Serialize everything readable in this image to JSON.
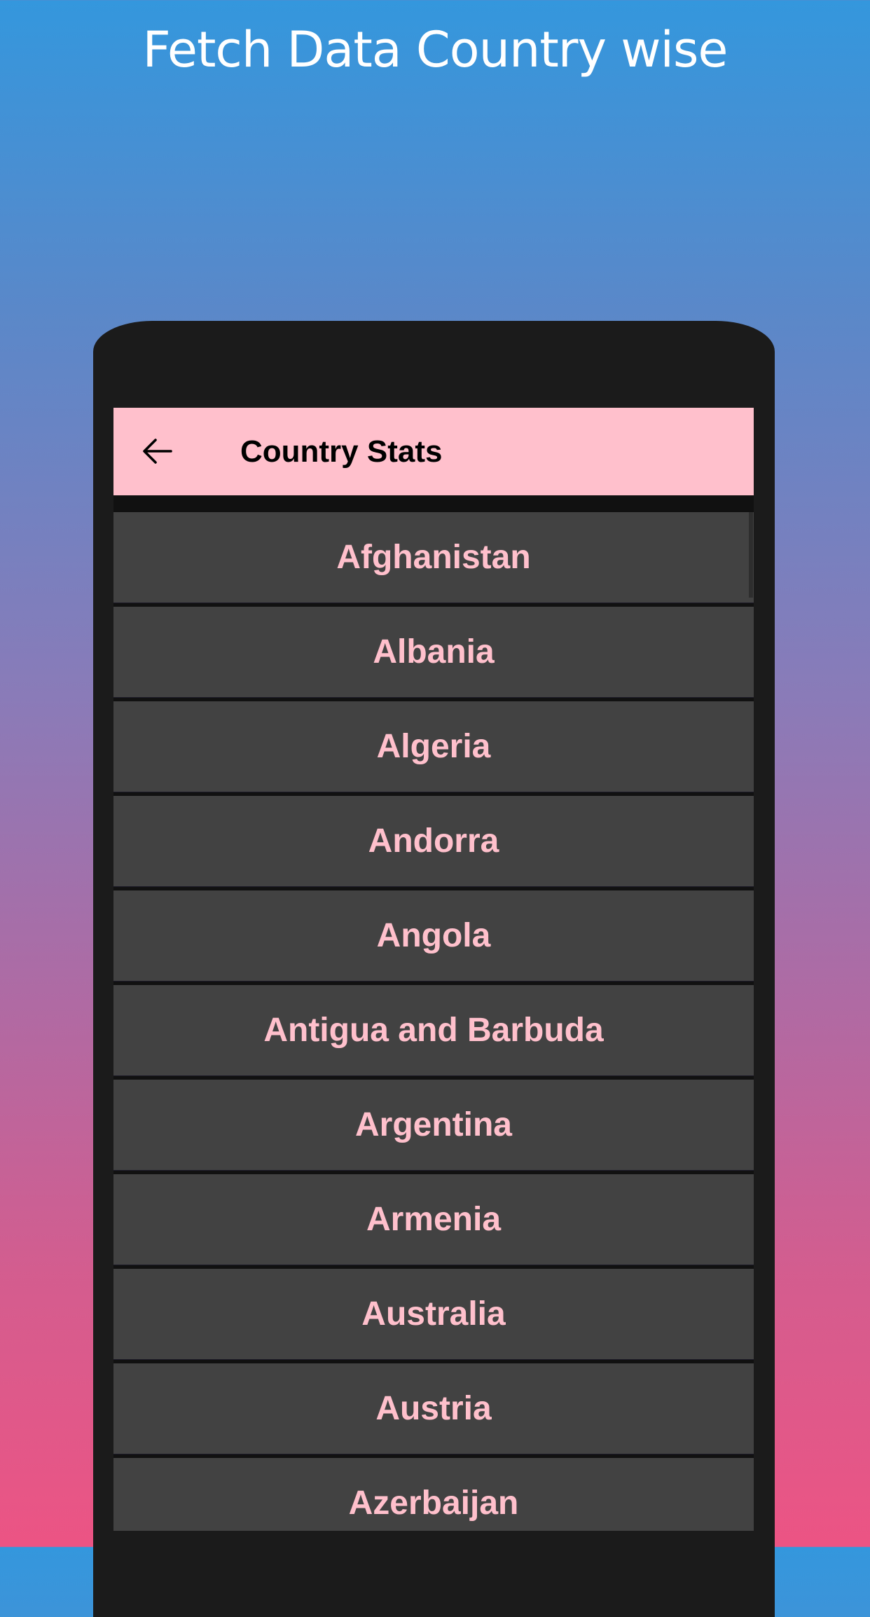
{
  "banner": {
    "title": "Fetch Data Country wise"
  },
  "appbar": {
    "back_icon": "arrow-left-icon",
    "title": "Country Stats",
    "background_color": "#ffc0cc"
  },
  "countries": [
    "Afghanistan",
    "Albania",
    "Algeria",
    "Andorra",
    "Angola",
    "Antigua and Barbuda",
    "Argentina",
    "Armenia",
    "Australia",
    "Austria",
    "Azerbaijan"
  ],
  "colors": {
    "row_background": "#424242",
    "row_text": "#ffc0cc",
    "gradient_top": "#3497dd",
    "gradient_bottom": "#ec5484"
  }
}
